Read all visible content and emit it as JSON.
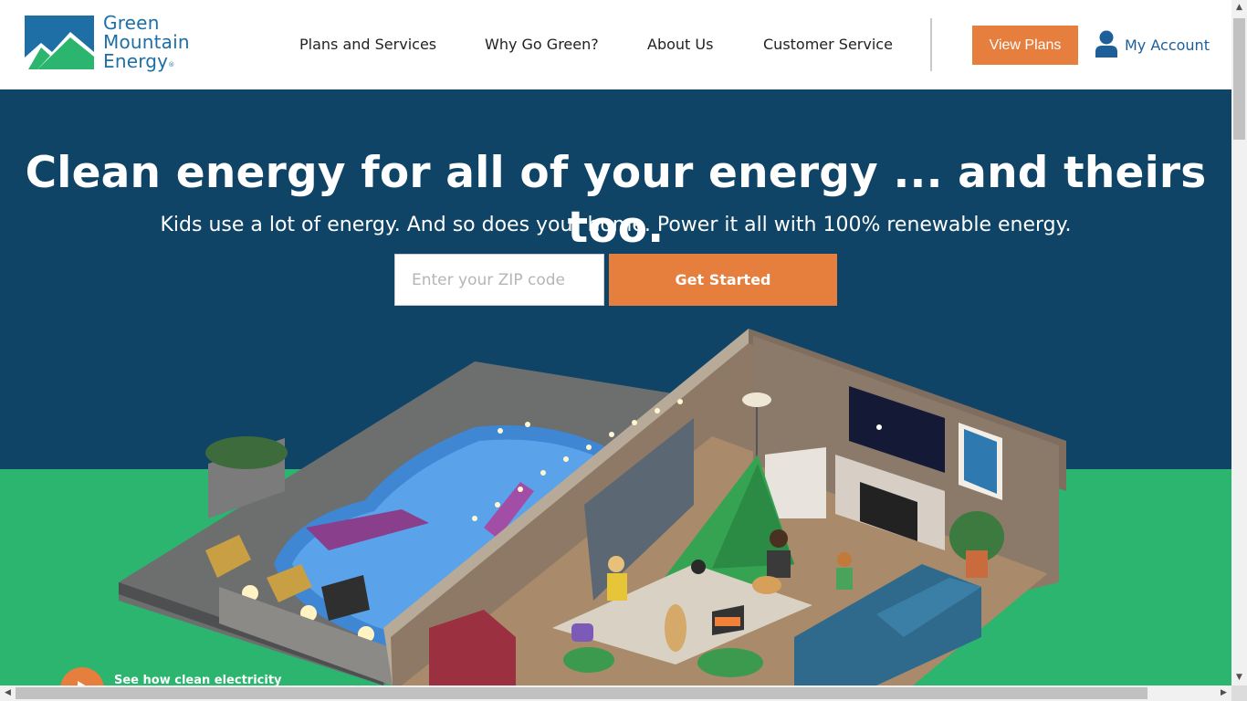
{
  "brand": {
    "line1": "Green",
    "line2": "Mountain",
    "line3": "Energy",
    "registered": "®",
    "colors": {
      "blue": "#1d6fa5",
      "green": "#2bb56e",
      "navy": "#0f4466",
      "orange": "#e67e3d"
    }
  },
  "nav": {
    "items": [
      {
        "label": "Plans and Services"
      },
      {
        "label": "Why Go Green?"
      },
      {
        "label": "About Us"
      },
      {
        "label": "Customer Service"
      }
    ],
    "view_plans_label": "View Plans",
    "account_label": "My Account",
    "account_icon": "user-icon"
  },
  "hero": {
    "title": "Clean energy for all of your energy ... and theirs too.",
    "subtitle": "Kids use a lot of energy. And so does your home. Power it all with 100% renewable energy.",
    "zip_placeholder": "Enter your ZIP code",
    "zip_value": "",
    "cta_label": "Get Started",
    "video_label": "See how clean electricity",
    "video_icon": "play-icon"
  },
  "scrollbars": {
    "up_icon": "▲",
    "down_icon": "▼",
    "left_icon": "◀",
    "right_icon": "▶"
  }
}
